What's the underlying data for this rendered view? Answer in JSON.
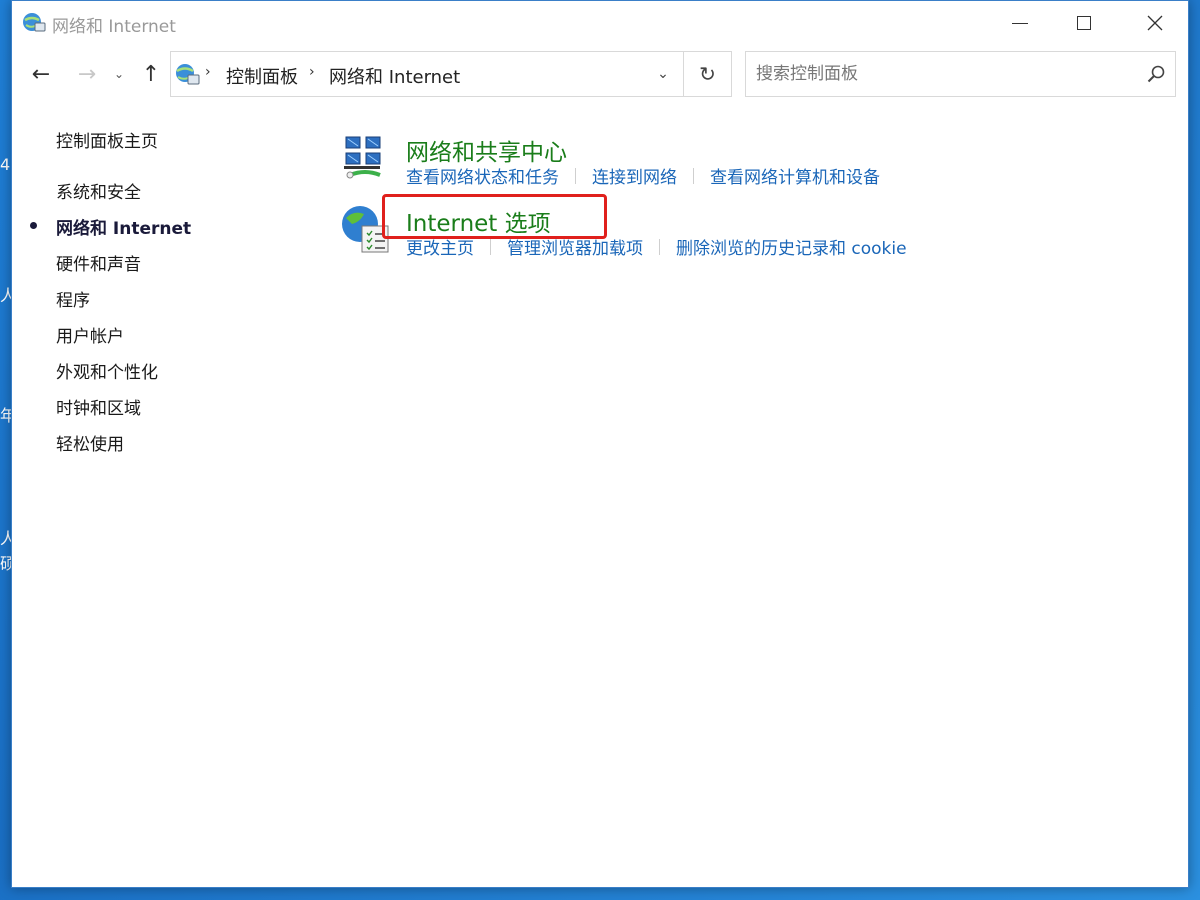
{
  "window": {
    "title": "网络和 Internet"
  },
  "desktop": {
    "edge_chars": [
      "4",
      "人",
      "年",
      "人",
      "硕"
    ]
  },
  "nav": {
    "back": "←",
    "forward": "→",
    "recent": "⌄",
    "up": "↑"
  },
  "address": {
    "crumbs": [
      "控制面板",
      "网络和 Internet"
    ],
    "separator": "›",
    "dropdown": "⌄",
    "refresh": "↻"
  },
  "search": {
    "placeholder": "搜索控制面板"
  },
  "sidebar": {
    "items": [
      {
        "label": "控制面板主页",
        "active": false
      },
      {
        "label": "系统和安全",
        "active": false
      },
      {
        "label": "网络和 Internet",
        "active": true
      },
      {
        "label": "硬件和声音",
        "active": false
      },
      {
        "label": "程序",
        "active": false
      },
      {
        "label": "用户帐户",
        "active": false
      },
      {
        "label": "外观和个性化",
        "active": false
      },
      {
        "label": "时钟和区域",
        "active": false
      },
      {
        "label": "轻松使用",
        "active": false
      }
    ]
  },
  "categories": [
    {
      "title": "网络和共享中心",
      "icon": "network-sharing-icon",
      "links": [
        "查看网络状态和任务",
        "连接到网络",
        "查看网络计算机和设备"
      ]
    },
    {
      "title": "Internet 选项",
      "icon": "internet-options-icon",
      "links": [
        "更改主页",
        "管理浏览器加载项",
        "删除浏览的历史记录和 cookie"
      ]
    }
  ],
  "colors": {
    "category_title": "#1a7d1a",
    "link": "#1a66b8",
    "highlight": "#e0201c",
    "desktop": "#1f7fd6"
  }
}
